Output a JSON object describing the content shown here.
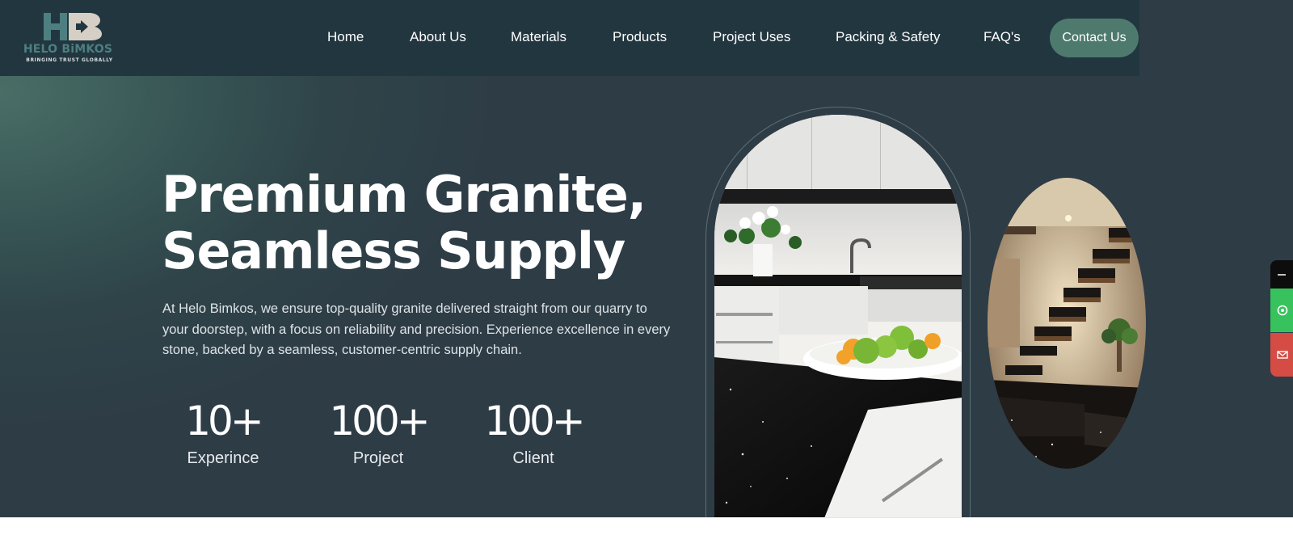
{
  "brand": {
    "name": "HELO BiMKOS",
    "tagline": "BRINGING TRUST GLOBALLY",
    "colors": {
      "accent": "#4e7a6e",
      "header": "#223640",
      "logo_text": "#4e7f80"
    }
  },
  "nav": {
    "items": [
      {
        "label": "Home"
      },
      {
        "label": "About Us"
      },
      {
        "label": "Materials"
      },
      {
        "label": "Products"
      },
      {
        "label": "Project Uses"
      },
      {
        "label": "Packing & Safety"
      },
      {
        "label": "FAQ's"
      }
    ],
    "cta_label": "Contact Us"
  },
  "hero": {
    "title_line1": "Premium Granite,",
    "title_line2": "Seamless Supply",
    "description": "At Helo Bimkos, we ensure top-quality granite delivered straight from our quarry to your doorstep, with a focus on reliability and precision. Experience excellence in every stone, backed by a seamless, customer-centric supply chain.",
    "stats": [
      {
        "value": "10+",
        "label": "Experince"
      },
      {
        "value": "100+",
        "label": "Project"
      },
      {
        "value": "100+",
        "label": "Client"
      }
    ],
    "images": [
      {
        "name": "kitchen-granite-photo"
      },
      {
        "name": "granite-staircase-photo"
      }
    ]
  },
  "floating_buttons": [
    {
      "icon": "arrow-up-icon",
      "color": "#0d0d0d"
    },
    {
      "icon": "whatsapp-icon",
      "color": "#37c25d"
    },
    {
      "icon": "mail-icon",
      "color": "#d54c45"
    }
  ]
}
